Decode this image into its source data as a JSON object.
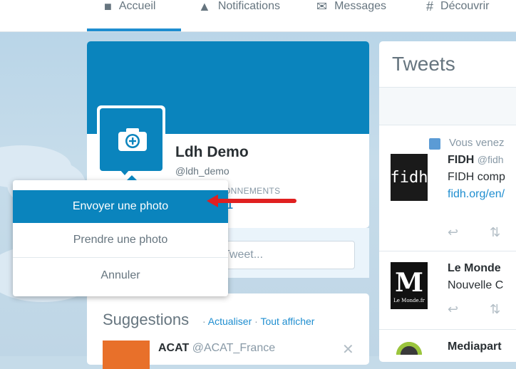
{
  "nav": {
    "items": [
      {
        "label": "Accueil",
        "icon": "home-icon"
      },
      {
        "label": "Notifications",
        "icon": "bell-icon"
      },
      {
        "label": "Messages",
        "icon": "envelope-icon"
      },
      {
        "label": "Découvrir",
        "icon": "hashtag-icon"
      }
    ]
  },
  "profile": {
    "name": "Ldh Demo",
    "handle": "@ldh_demo",
    "stat_label": "ONNEMENTS",
    "stat_value": "1"
  },
  "compose": {
    "placeholder": "Tweet..."
  },
  "menu": {
    "upload": "Envoyer une photo",
    "take": "Prendre une photo",
    "cancel": "Annuler"
  },
  "suggestions": {
    "title": "Suggestions",
    "refresh": "Actualiser",
    "show_all": "Tout afficher",
    "items": [
      {
        "name": "ACAT",
        "handle": "@ACAT_France"
      }
    ]
  },
  "tweets": {
    "title": "Tweets",
    "items": [
      {
        "context": "Vous venez",
        "name": "FIDH",
        "handle": "@fidh",
        "avatar_text": "fidh",
        "text": "FIDH comp",
        "link": "fidh.org/en/"
      },
      {
        "name": "Le Monde",
        "text": "Nouvelle C",
        "avatar_text": "M",
        "avatar_sub": "Le Monde.fr"
      },
      {
        "name": "Mediapart"
      }
    ]
  },
  "colors": {
    "accent": "#0a84bd",
    "link": "#1f8ed0",
    "annotation_arrow": "#e02020"
  }
}
